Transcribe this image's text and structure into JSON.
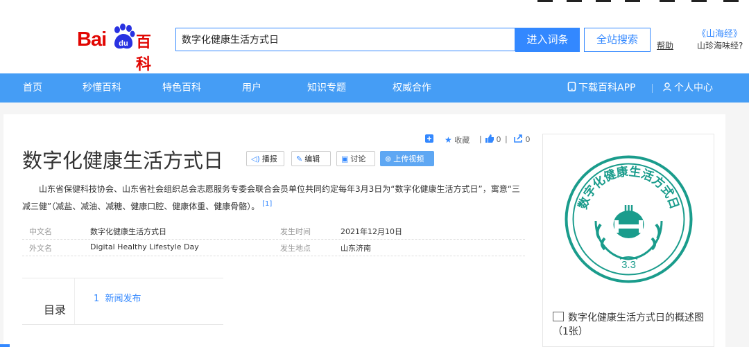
{
  "header": {
    "logo_text_bai": "Bai",
    "logo_text_du": "du",
    "logo_text_baike": "百科",
    "search_value": "数字化健康生活方式日",
    "enter_button": "进入词条",
    "site_search_button": "全站搜索",
    "help_link": "帮助",
    "promo_title": "《山海经》",
    "promo_subtitle": "山珍海味经?"
  },
  "nav": {
    "items": [
      "首页",
      "秒懂百科",
      "特色百科",
      "用户",
      "知识专题",
      "权威合作"
    ],
    "download_app": "下载百科APP",
    "user_center": "个人中心"
  },
  "toolbar": {
    "favorite_label": "收藏",
    "like_count": "0",
    "share_count": "0"
  },
  "entry": {
    "title": "数字化健康生活方式日",
    "buttons": {
      "play": "播报",
      "edit": "编辑",
      "discuss": "讨论",
      "upload_video": "上传视频"
    },
    "summary": "山东省保健科技协会、山东省社会组织总会志愿服务专委会联合会员单位共同约定每年3月3日为“数字化健康生活方式日”，寓意“三减三健”（减盐、减油、减糖、健康口腔、健康体重、健康骨骼）。",
    "summary_ref": "[1]"
  },
  "infobox": {
    "rows": [
      {
        "k1": "中文名",
        "v1": "数字化健康生活方式日",
        "k2": "发生时间",
        "v2": "2021年12月10日"
      },
      {
        "k1": "外文名",
        "v1": "Digital Healthy Lifestyle Day",
        "k2": "发生地点",
        "v2": "山东济南"
      }
    ]
  },
  "toc": {
    "label": "目录",
    "entries": [
      {
        "num": "1",
        "text": "新闻发布"
      }
    ]
  },
  "image": {
    "logo_text": "数字化健康生活方式日",
    "logo_number": "3.3",
    "caption": "数字化健康生活方式日的概述图（1张）"
  },
  "colors": {
    "accent": "#3388ff",
    "nav_bg": "#459df5",
    "brand_red": "#e10602",
    "logo_teal": "#1a9c8c"
  }
}
